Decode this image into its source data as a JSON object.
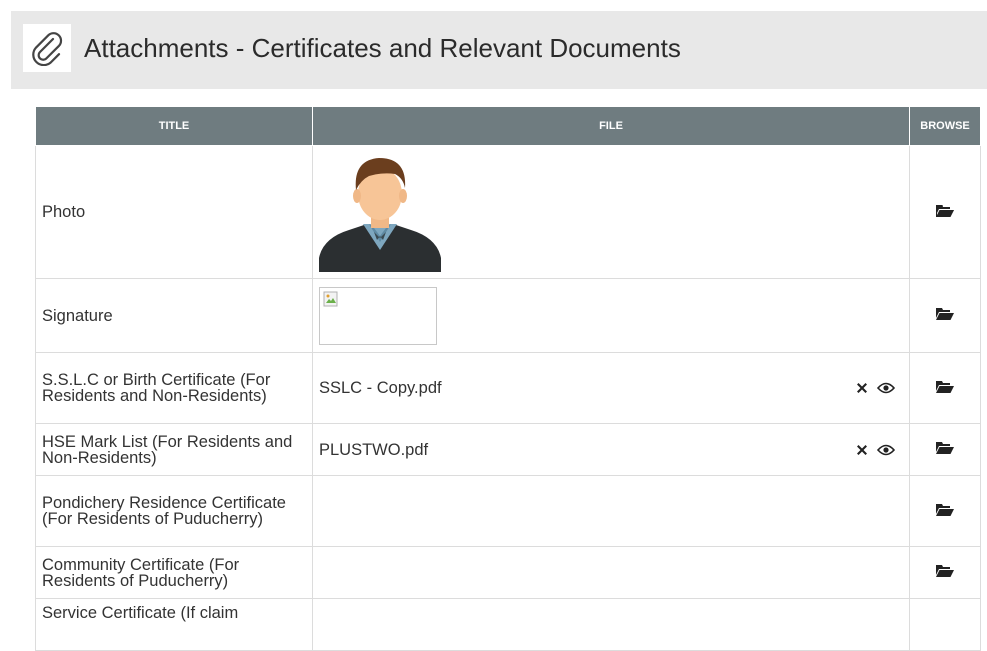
{
  "header": {
    "title": "Attachments - Certificates and Relevant Documents",
    "icon": "paperclip-icon"
  },
  "table": {
    "columns": {
      "title": "TITLE",
      "file": "FILE",
      "browse": "BROWSE"
    },
    "rows": [
      {
        "title": "Photo",
        "file": "",
        "kind": "photo"
      },
      {
        "title": "Signature",
        "file": "",
        "kind": "signature"
      },
      {
        "title": "S.S.L.C or Birth Certificate (For Residents and Non-Residents)",
        "file": "SSLC - Copy.pdf",
        "kind": "file"
      },
      {
        "title": "HSE Mark List (For Residents and Non-Residents)",
        "file": "PLUSTWO.pdf",
        "kind": "file"
      },
      {
        "title": "Pondichery Residence Certificate (For Residents of Puducherry)",
        "file": "",
        "kind": "empty"
      },
      {
        "title": "Community Certificate (For Residents of Puducherry)",
        "file": "",
        "kind": "empty"
      },
      {
        "title": "Service Certificate (If claim",
        "file": "",
        "kind": "empty"
      }
    ]
  },
  "colors": {
    "header_bg": "#e8e8e8",
    "table_header_bg": "#6f7c80",
    "icon_dark": "#222222"
  }
}
